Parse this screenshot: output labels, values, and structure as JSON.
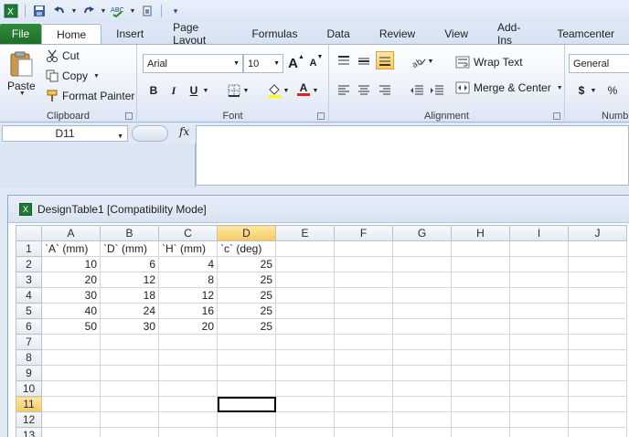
{
  "quick_access": {
    "items": [
      "excel-icon",
      "save-icon",
      "undo-icon",
      "redo-icon",
      "spellcheck-icon",
      "attach-icon",
      "customize-icon"
    ]
  },
  "tabs": {
    "file": "File",
    "items": [
      "Home",
      "Insert",
      "Page Layout",
      "Formulas",
      "Data",
      "Review",
      "View",
      "Add-Ins",
      "Teamcenter"
    ],
    "active": "Home"
  },
  "ribbon": {
    "clipboard": {
      "label": "Clipboard",
      "paste": "Paste",
      "cut": "Cut",
      "copy": "Copy",
      "format_painter": "Format Painter"
    },
    "font": {
      "label": "Font",
      "font_name": "Arial",
      "font_size": "10",
      "bold": "B",
      "italic": "I",
      "underline": "U",
      "increase": "A",
      "decrease": "A",
      "font_color": "A"
    },
    "alignment": {
      "label": "Alignment",
      "wrap_text": "Wrap Text",
      "merge_center": "Merge & Center"
    },
    "number": {
      "label": "Numb",
      "format": "General",
      "currency": "$",
      "percent": "%"
    }
  },
  "formula_bar": {
    "name_box": "D11",
    "fx": "fx",
    "formula": ""
  },
  "workbook": {
    "title": "DesignTable1  [Compatibility Mode]",
    "columns": [
      "A",
      "B",
      "C",
      "D",
      "E",
      "F",
      "G",
      "H",
      "I",
      "J"
    ],
    "selected_column": "D",
    "selected_row": "11",
    "active_cell": "D11",
    "rows": [
      {
        "n": "1",
        "cells": [
          "`A` (mm)",
          "`D` (mm)",
          "`H` (mm)",
          "`c` (deg)",
          "",
          "",
          "",
          "",
          "",
          ""
        ]
      },
      {
        "n": "2",
        "cells": [
          "10",
          "6",
          "4",
          "25",
          "",
          "",
          "",
          "",
          "",
          ""
        ]
      },
      {
        "n": "3",
        "cells": [
          "20",
          "12",
          "8",
          "25",
          "",
          "",
          "",
          "",
          "",
          ""
        ]
      },
      {
        "n": "4",
        "cells": [
          "30",
          "18",
          "12",
          "25",
          "",
          "",
          "",
          "",
          "",
          ""
        ]
      },
      {
        "n": "5",
        "cells": [
          "40",
          "24",
          "16",
          "25",
          "",
          "",
          "",
          "",
          "",
          ""
        ]
      },
      {
        "n": "6",
        "cells": [
          "50",
          "30",
          "20",
          "25",
          "",
          "",
          "",
          "",
          "",
          ""
        ]
      },
      {
        "n": "7",
        "cells": [
          "",
          "",
          "",
          "",
          "",
          "",
          "",
          "",
          "",
          ""
        ]
      },
      {
        "n": "8",
        "cells": [
          "",
          "",
          "",
          "",
          "",
          "",
          "",
          "",
          "",
          ""
        ]
      },
      {
        "n": "9",
        "cells": [
          "",
          "",
          "",
          "",
          "",
          "",
          "",
          "",
          "",
          ""
        ]
      },
      {
        "n": "10",
        "cells": [
          "",
          "",
          "",
          "",
          "",
          "",
          "",
          "",
          "",
          ""
        ]
      },
      {
        "n": "11",
        "cells": [
          "",
          "",
          "",
          "",
          "",
          "",
          "",
          "",
          "",
          ""
        ]
      },
      {
        "n": "12",
        "cells": [
          "",
          "",
          "",
          "",
          "",
          "",
          "",
          "",
          "",
          ""
        ]
      },
      {
        "n": "13",
        "cells": [
          "",
          "",
          "",
          "",
          "",
          "",
          "",
          "",
          "",
          ""
        ]
      }
    ]
  },
  "colors": {
    "file_tab": "#1f6f2a",
    "selected_header": "#f7c95c",
    "ribbon_border": "#9fb5d3"
  }
}
